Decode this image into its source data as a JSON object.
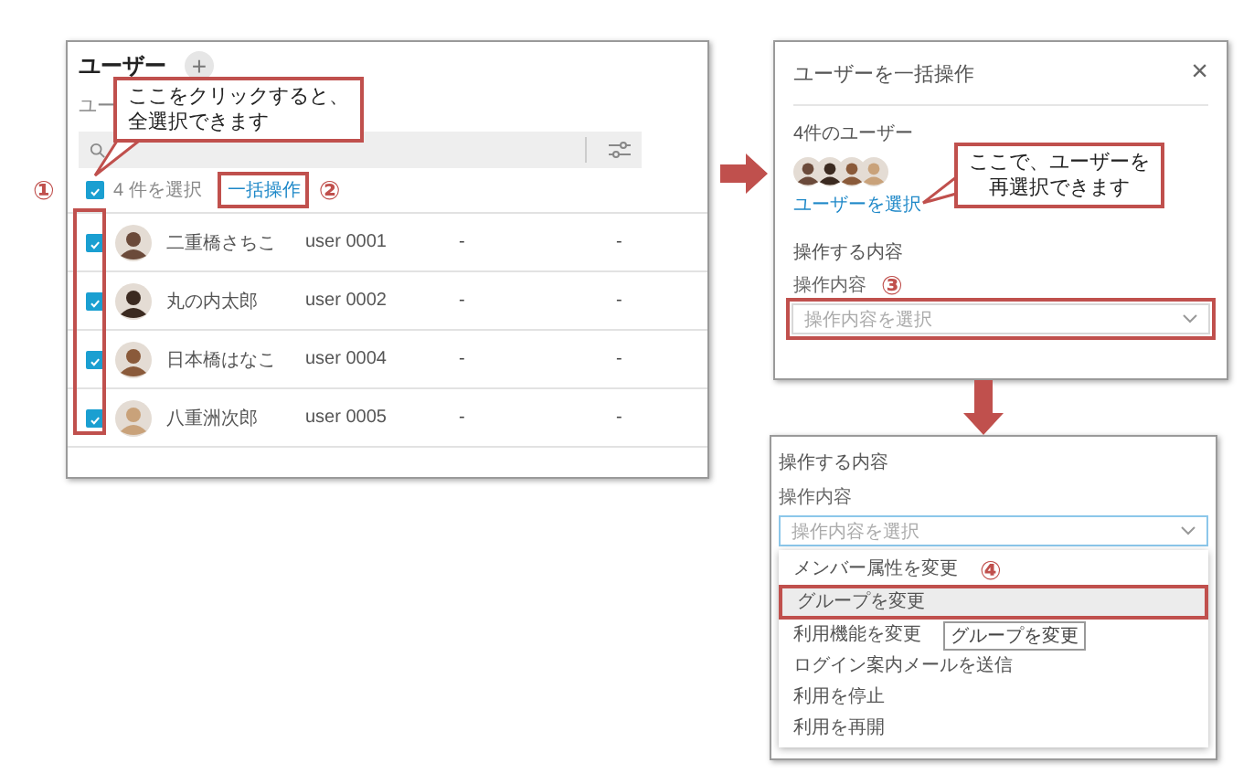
{
  "user_list": {
    "title": "ユーザー",
    "add_button": "+",
    "subtitle": "ユー",
    "select_all": {
      "checked": true,
      "count": "4 件を選択",
      "bulk_action": "一括操作"
    },
    "rows": [
      {
        "checked": true,
        "name": "二重橋さちこ",
        "user_id": "user 0001",
        "column_3": "-",
        "column_4": "-"
      },
      {
        "checked": true,
        "name": "丸の内太郎",
        "user_id": "user 0002",
        "column_3": "-",
        "column_4": "-"
      },
      {
        "checked": true,
        "name": "日本橋はなこ",
        "user_id": "user 0004",
        "column_3": "-",
        "column_4": "-"
      },
      {
        "checked": true,
        "name": "八重洲次郎",
        "user_id": "user 0005",
        "column_3": "-",
        "column_4": "-"
      }
    ]
  },
  "bulk_dialog": {
    "title": "ユーザーを一括操作",
    "close": "×",
    "users_heading": "4件のユーザー",
    "select_users_link": "ユーザーを選択",
    "section_heading": "操作する内容",
    "field_label": "操作内容",
    "field_placeholder": "操作内容を選択"
  },
  "dropdown_view": {
    "section_heading": "操作する内容",
    "field_label": "操作内容",
    "field_placeholder": "操作内容を選択",
    "options": [
      {
        "label": "メンバー属性を変更",
        "highlighted": false
      },
      {
        "label": "グループを変更",
        "highlighted": true
      },
      {
        "label": "利用機能を変更",
        "highlighted": false
      },
      {
        "label": "ログイン案内メールを送信",
        "highlighted": false
      },
      {
        "label": "利用を停止",
        "highlighted": false
      },
      {
        "label": "利用を再開",
        "highlighted": false
      }
    ],
    "tooltip": "グループを変更"
  },
  "annotations": {
    "step_1": "①",
    "step_2": "②",
    "step_3": "③",
    "step_4": "④",
    "callout_select_all": [
      "ここをクリックすると、",
      "全選択できます"
    ],
    "callout_reselect": [
      "ここで、ユーザーを",
      "再選択できます"
    ]
  }
}
